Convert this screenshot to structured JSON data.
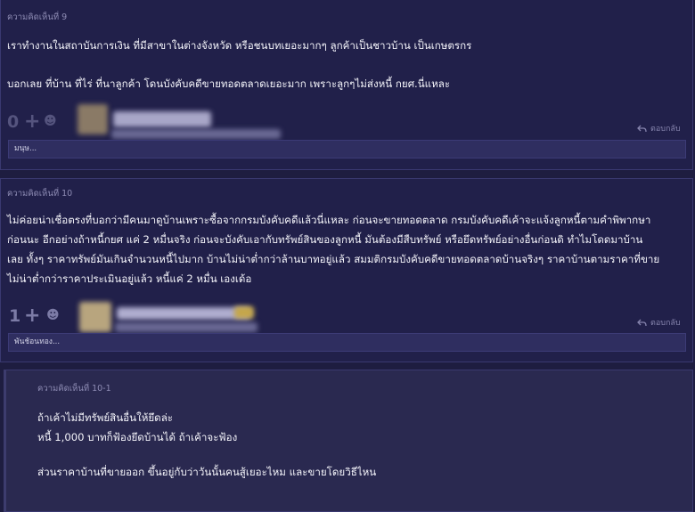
{
  "comments": [
    {
      "number_label": "ความคิดเห็นที่ 9",
      "paragraphs": [
        "เราทำงานในสถาบันการเงิน ที่มีสาขาในต่างจังหวัด หรือชนบทเยอะมากๆ ลูกค้าเป็นชาวบ้าน เป็นเกษตรกร",
        "บอกเลย ที่บ้าน ที่ไร่ ที่นาลูกค้า โดนบังคับคดีขายทอดตลาดเยอะมาก เพราะลูกๆไม่ส่งหนี้ กยศ.นี่แหละ"
      ],
      "score": "0",
      "reply_label": "ตอบกลับ",
      "reply_field_text": "มนุษ..."
    },
    {
      "number_label": "ความคิดเห็นที่ 10",
      "paragraphs": [
        "ไม่ค่อยน่าเชื่อตรงที่บอกว่ามีคนมาดูบ้านเพราะซื้อจากกรมบังคับคดีแล้วนี่แหละ ก่อนจะขายทอดตลาด กรมบังคับคดีเค้าจะแจ้งลูกหนี้ตามคำพิพากษา",
        "ก่อนนะ อีกอย่างถ้าหนี้กยศ แค่ 2 หมื่นจริง ก่อนจะบังคับเอากับทรัพย์สินของลูกหนี้ มันต้องมีสืบทรัพย์ หรือยึดทรัพย์อย่างอื่นก่อนดิ ทำไมโดดมาบ้าน",
        "เลย ทั้งๆ ราคาทรัพย์มันเกินจำนวนหนี้ไปมาก บ้านไม่น่าต่ำกว่าล้านบาทอยู่แล้ว สมมติกรมบังคับคดีขายทอดตลาดบ้านจริงๆ ราคาบ้านตามราคาที่ขาย",
        "ไม่น่าต่ำกว่าราคาประเมินอยู่แล้ว หนี้แค่ 2 หมื่น เองเด้อ"
      ],
      "score": "1",
      "reply_label": "ตอบกลับ",
      "reply_field_text": "พันช้อนทอง..."
    },
    {
      "number_label": "ความคิดเห็นที่ 10-1",
      "paragraphs": [
        "ถ้าเค้าไม่มีทรัพย์สินอื่นให้ยึดล่ะ",
        "หนี้ 1,000 บาทก็ฟ้องยึดบ้านได้ ถ้าเค้าจะฟ้อง",
        "ส่วนราคาบ้านที่ขายออก ขึ้นอยู่กับว่าวันนั้นคนสู้เยอะไหม และขายโดยวิธีไหน"
      ]
    }
  ],
  "colors": {
    "background": "#1e1d40",
    "card": "#21204a",
    "subcard": "#2a2950",
    "muted_text": "#8e8cb4",
    "body_text": "#f4f4fa"
  },
  "icons": {
    "plus": "plus-icon",
    "emotion": "emoji-icon",
    "reply": "reply-arrow-icon"
  }
}
